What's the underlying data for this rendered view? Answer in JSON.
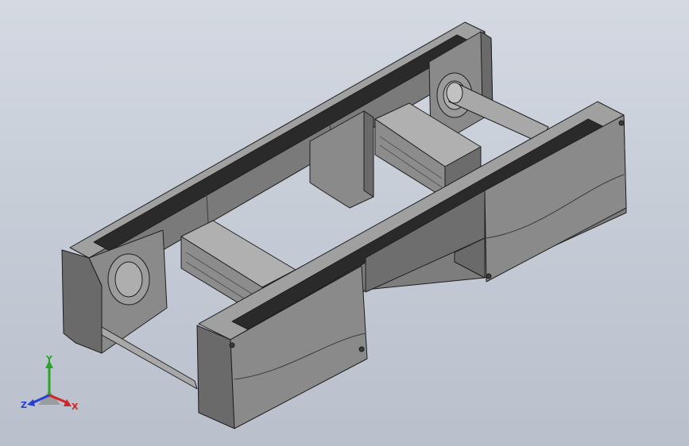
{
  "viewport": {
    "background_top": "#d4d9e2",
    "background_bottom": "#b9c0cc"
  },
  "model": {
    "body_color": "#7d7d7d",
    "body_light": "#a3a3a3",
    "body_dark": "#4e4e4e",
    "edge_color": "#1e1e1e",
    "belt_color": "#2a2a2a",
    "shaft_color": "#9a9a9a"
  },
  "triad": {
    "y_label": "Y",
    "x_label": "X",
    "z_label": "Z",
    "y_color": "#2aa52a",
    "x_color": "#d22424",
    "z_color": "#2a3fd2"
  }
}
